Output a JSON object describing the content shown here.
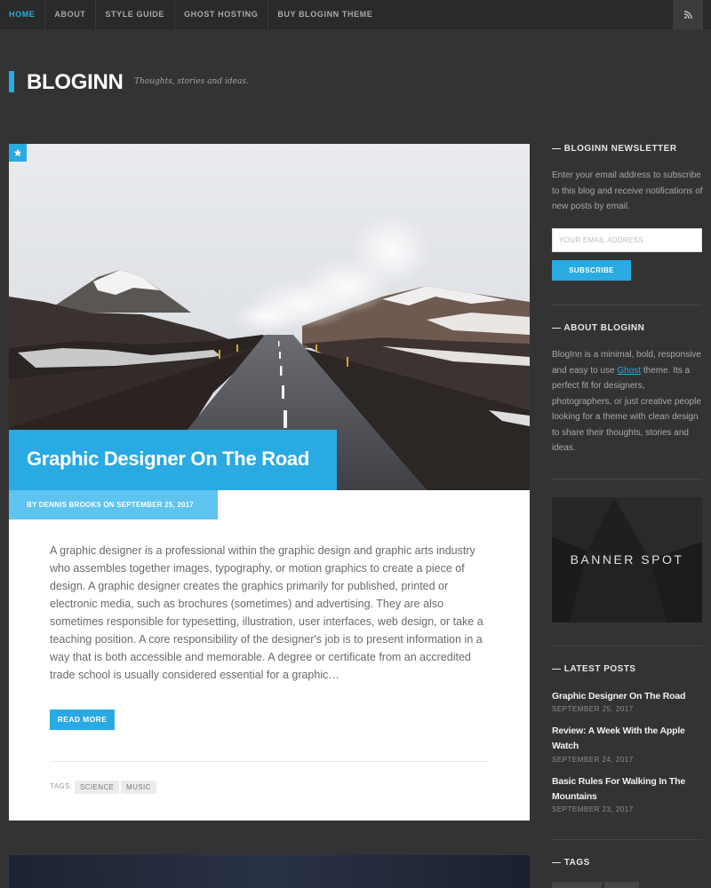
{
  "nav": {
    "items": [
      "HOME",
      "ABOUT",
      "STYLE GUIDE",
      "GHOST HOSTING",
      "BUY BLOGINN THEME"
    ],
    "active": "HOME",
    "rss_icon": "rss-icon"
  },
  "header": {
    "brand": "BLOGINN",
    "tagline": "Thoughts, stories and ideas."
  },
  "post": {
    "featured_icon": "star-icon",
    "title": "Graphic Designer On The Road",
    "meta": "BY DENNIS BROOKS ON SEPTEMBER 25, 2017",
    "excerpt": "A graphic designer is a professional within the graphic design and graphic arts industry who assembles together images, typography, or motion graphics to create a piece of design. A graphic designer creates the graphics primarily for published, printed or electronic media, such as brochures (sometimes) and advertising. They are also sometimes responsible for typesetting, illustration, user interfaces, web design, or take a teaching position. A core responsibility of the designer's job is to present information in a way that is both accessible and memorable. A degree or certificate from an accredited trade school is usually considered essential for a graphic…",
    "read_more": "READ MORE",
    "tags_label": "TAGS:",
    "tags": [
      "SCIENCE",
      "MUSIC"
    ]
  },
  "sidebar": {
    "newsletter": {
      "heading": "— BLOGINN NEWSLETTER",
      "text": "Enter your email address to subscribe to this blog and receive notifications of new posts by email.",
      "placeholder": "YOUR EMAIL ADDRESS",
      "button": "SUBSCRIBE"
    },
    "about": {
      "heading": "— ABOUT BLOGINN",
      "text_before": "BlogInn is a minimal, bold, responsive and easy to use ",
      "link": "Ghost",
      "text_after": " theme. Its a perfect fit for designers, photographers, or just creative people looking for a theme with clean design to share their thoughts, stories and ideas."
    },
    "banner": "BANNER SPOT",
    "latest": {
      "heading": "— LATEST POSTS",
      "posts": [
        {
          "title": "Graphic Designer On The Road",
          "date": "SEPTEMBER 25, 2017"
        },
        {
          "title": "Review: A Week With the Apple Watch",
          "date": "SEPTEMBER 24, 2017"
        },
        {
          "title": "Basic Rules For Walking In The Mountains",
          "date": "SEPTEMBER 23, 2017"
        }
      ]
    },
    "tags_heading": "— TAGS"
  },
  "colors": {
    "accent": "#29aae2",
    "background": "#333334"
  }
}
